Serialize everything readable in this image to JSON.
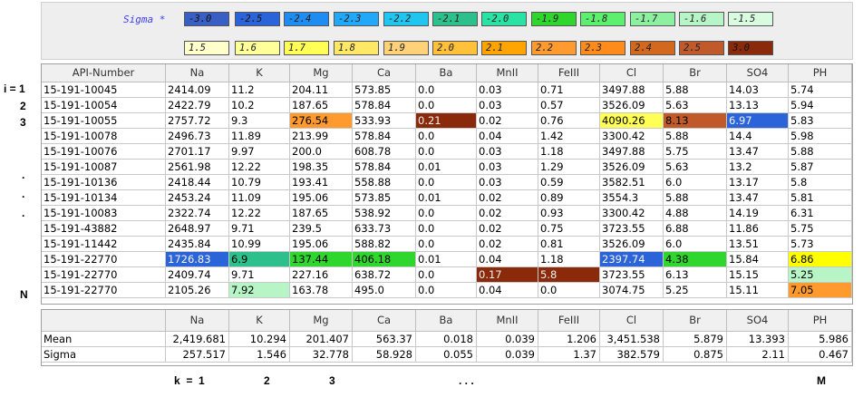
{
  "legend": {
    "title": "Sigma *",
    "row1": [
      {
        "label": "-3.0",
        "color": "#3a5fc4"
      },
      {
        "label": "-2.5",
        "color": "#2a64d8"
      },
      {
        "label": "-2.4",
        "color": "#1e8cf0"
      },
      {
        "label": "-2.3",
        "color": "#22a8f8"
      },
      {
        "label": "-2.2",
        "color": "#20c6f0"
      },
      {
        "label": "-2.1",
        "color": "#2ec08c"
      },
      {
        "label": "-2.0",
        "color": "#29e2a3"
      },
      {
        "label": "-1.9",
        "color": "#2ed62e"
      },
      {
        "label": "-1.8",
        "color": "#5cf06e"
      },
      {
        "label": "-1.7",
        "color": "#8cf0a0"
      },
      {
        "label": "-1.6",
        "color": "#b8f5c6"
      },
      {
        "label": "-1.5",
        "color": "#d9fbe0"
      }
    ],
    "row2": [
      {
        "label": "1.5",
        "color": "#ffffcc"
      },
      {
        "label": "1.6",
        "color": "#ffff99"
      },
      {
        "label": "1.7",
        "color": "#ffff55"
      },
      {
        "label": "1.8",
        "color": "#ffe866"
      },
      {
        "label": "1.9",
        "color": "#ffd27a"
      },
      {
        "label": "2.0",
        "color": "#ffc03a"
      },
      {
        "label": "2.1",
        "color": "#ffa400"
      },
      {
        "label": "2.2",
        "color": "#ff9a2e"
      },
      {
        "label": "2.3",
        "color": "#ff8c1a"
      },
      {
        "label": "2.4",
        "color": "#d3691e"
      },
      {
        "label": "2.5",
        "color": "#c05a2b"
      },
      {
        "label": "3.0",
        "color": "#8a2a0a"
      }
    ]
  },
  "table": {
    "columns": [
      "API-Number",
      "Na",
      "K",
      "Mg",
      "Ca",
      "Ba",
      "MnII",
      "FeIII",
      "Cl",
      "Br",
      "SO4",
      "PH"
    ],
    "rows": [
      [
        "15-191-10045",
        "2414.09",
        "11.2",
        "204.11",
        "573.85",
        "0.0",
        "0.03",
        "0.71",
        "3497.88",
        "5.88",
        "14.03",
        "5.74"
      ],
      [
        "15-191-10054",
        "2422.79",
        "10.2",
        "187.65",
        "578.84",
        "0.0",
        "0.03",
        "0.57",
        "3526.09",
        "5.63",
        "13.13",
        "5.94"
      ],
      [
        "15-191-10055",
        "2757.72",
        "9.3",
        "276.54",
        "533.93",
        "0.21",
        "0.02",
        "0.76",
        "4090.26",
        "8.13",
        "6.97",
        "5.83"
      ],
      [
        "15-191-10078",
        "2496.73",
        "11.89",
        "213.99",
        "578.84",
        "0.0",
        "0.04",
        "1.42",
        "3300.42",
        "5.88",
        "14.4",
        "5.98"
      ],
      [
        "15-191-10076",
        "2701.17",
        "9.97",
        "200.0",
        "608.78",
        "0.0",
        "0.03",
        "1.18",
        "3497.88",
        "5.75",
        "13.47",
        "5.88"
      ],
      [
        "15-191-10087",
        "2561.98",
        "12.22",
        "198.35",
        "578.84",
        "0.01",
        "0.03",
        "1.29",
        "3526.09",
        "5.63",
        "13.2",
        "5.87"
      ],
      [
        "15-191-10136",
        "2418.44",
        "10.79",
        "193.41",
        "558.88",
        "0.0",
        "0.03",
        "0.59",
        "3582.51",
        "6.0",
        "13.17",
        "5.8"
      ],
      [
        "15-191-10134",
        "2453.24",
        "11.09",
        "195.06",
        "573.85",
        "0.01",
        "0.02",
        "0.89",
        "3554.3",
        "5.88",
        "13.47",
        "5.81"
      ],
      [
        "15-191-10083",
        "2322.74",
        "12.22",
        "187.65",
        "538.92",
        "0.0",
        "0.02",
        "0.93",
        "3300.42",
        "4.88",
        "14.19",
        "6.31"
      ],
      [
        "15-191-43882",
        "2648.97",
        "9.71",
        "239.5",
        "633.73",
        "0.0",
        "0.02",
        "0.75",
        "3723.55",
        "6.88",
        "11.86",
        "5.75"
      ],
      [
        "15-191-11442",
        "2435.84",
        "10.99",
        "195.06",
        "588.82",
        "0.0",
        "0.02",
        "0.81",
        "3526.09",
        "6.0",
        "13.51",
        "5.73"
      ],
      [
        "15-191-22770",
        "1726.83",
        "6.9",
        "137.44",
        "406.18",
        "0.01",
        "0.04",
        "1.18",
        "2397.74",
        "4.38",
        "15.84",
        "6.86"
      ],
      [
        "15-191-22770",
        "2409.74",
        "9.71",
        "227.16",
        "638.72",
        "0.0",
        "0.17",
        "5.8",
        "3723.55",
        "6.13",
        "15.15",
        "5.25"
      ],
      [
        "15-191-22770",
        "2105.26",
        "7.92",
        "163.78",
        "495.0",
        "0.0",
        "0.04",
        "0.0",
        "3074.75",
        "5.25",
        "15.11",
        "7.05"
      ]
    ],
    "highlights": [
      {
        "row": 2,
        "col": 3,
        "color": "#ff9a2e"
      },
      {
        "row": 2,
        "col": 5,
        "color": "#8a2a0a"
      },
      {
        "row": 2,
        "col": 8,
        "color": "#ffff55"
      },
      {
        "row": 2,
        "col": 9,
        "color": "#c05a2b"
      },
      {
        "row": 2,
        "col": 10,
        "color": "#2a64d8"
      },
      {
        "row": 11,
        "col": 1,
        "color": "#2a64d8"
      },
      {
        "row": 11,
        "col": 2,
        "color": "#2ec08c"
      },
      {
        "row": 11,
        "col": 3,
        "color": "#2ed62e"
      },
      {
        "row": 11,
        "col": 4,
        "color": "#2ed62e"
      },
      {
        "row": 11,
        "col": 8,
        "color": "#2a64d8"
      },
      {
        "row": 11,
        "col": 9,
        "color": "#2ed62e"
      },
      {
        "row": 11,
        "col": 11,
        "color": "#ffff00"
      },
      {
        "row": 12,
        "col": 6,
        "color": "#8a2a0a"
      },
      {
        "row": 12,
        "col": 7,
        "color": "#8a2a0a"
      },
      {
        "row": 12,
        "col": 11,
        "color": "#b8f5c6"
      },
      {
        "row": 13,
        "col": 2,
        "color": "#b8f5c6"
      },
      {
        "row": 13,
        "col": 11,
        "color": "#ff9a2e"
      }
    ]
  },
  "stats": {
    "columns": [
      "",
      "Na",
      "K",
      "Mg",
      "Ca",
      "Ba",
      "MnII",
      "FeIII",
      "Cl",
      "Br",
      "SO4",
      "PH"
    ],
    "rows": [
      [
        "Mean",
        "2,419.681",
        "10.294",
        "201.407",
        "563.37",
        "0.018",
        "0.039",
        "1.206",
        "3,451.538",
        "5.879",
        "13.393",
        "5.986"
      ],
      [
        "Sigma",
        "257.517",
        "1.546",
        "32.778",
        "58.928",
        "0.055",
        "0.039",
        "1.37",
        "382.579",
        "0.875",
        "2.11",
        "0.467"
      ]
    ]
  },
  "side_labels": [
    "i = 1",
    "2",
    "3",
    ".",
    ".",
    ".",
    "N"
  ],
  "bottom_labels": [
    "k  =  1",
    "2",
    "3",
    ". . .",
    "M"
  ]
}
